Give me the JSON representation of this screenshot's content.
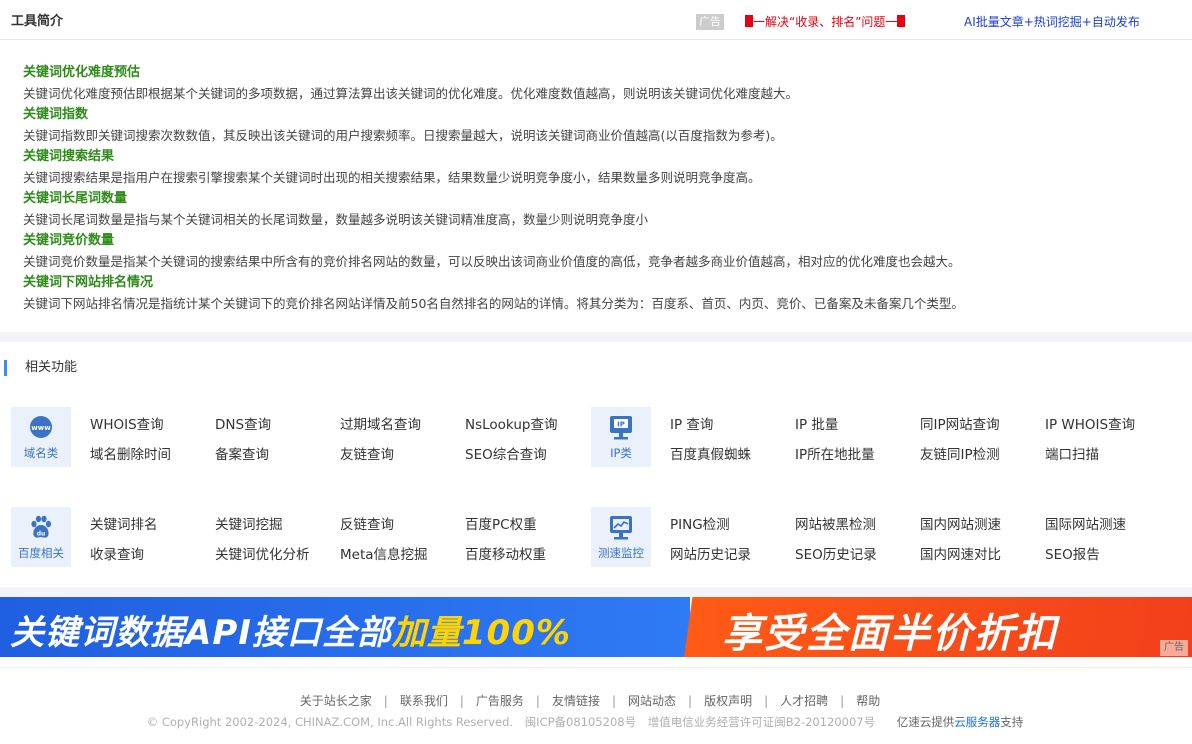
{
  "top": {
    "title": "工具简介",
    "ad_label": "广告",
    "promo_red": "一解决“收录、排名”问题一",
    "promo_blue": "AI批量文章+热词挖掘+自动发布"
  },
  "intro": [
    {
      "heading": "关键词优化难度预估",
      "text": "关键词优化难度预估即根据某个关键词的多项数据，通过算法算出该关键词的优化难度。优化难度数值越高，则说明该关键词优化难度越大。"
    },
    {
      "heading": "关键词指数",
      "text": "关键词指数即关键词搜索次数数值，其反映出该关键词的用户搜索频率。日搜索量越大，说明该关键词商业价值越高(以百度指数为参考)。"
    },
    {
      "heading": "关键词搜索结果",
      "text": "关键词搜索结果是指用户在搜索引擎搜索某个关键词时出现的相关搜索结果，结果数量少说明竞争度小，结果数量多则说明竞争度高。"
    },
    {
      "heading": "关键词长尾词数量",
      "text": "关键词长尾词数量是指与某个关键词相关的长尾词数量，数量越多说明该关键词精准度高，数量少则说明竞争度小"
    },
    {
      "heading": "关键词竞价数量",
      "text": "关键词竞价数量是指某个关键词的搜索结果中所含有的竞价排名网站的数量，可以反映出该词商业价值度的高低，竞争者越多商业价值越高，相对应的优化难度也会越大。"
    },
    {
      "heading": "关键词下网站排名情况",
      "text": "关键词下网站排名情况是指统计某个关键词下的竞价排名网站详情及前50名自然排名的网站的详情。将其分类为：百度系、首页、内页、竞价、已备案及未备案几个类型。"
    }
  ],
  "related": {
    "title": "相关功能",
    "categories": [
      {
        "label": "域名类",
        "icon": "www-icon",
        "links": [
          "WHOIS查询",
          "DNS查询",
          "过期域名查询",
          "NsLookup查询",
          "域名删除时间",
          "备案查询",
          "友链查询",
          "SEO综合查询"
        ]
      },
      {
        "label": "IP类",
        "icon": "ip-icon",
        "links": [
          "IP 查询",
          "IP 批量",
          "同IP网站查询",
          "IP WHOIS查询",
          "百度真假蜘蛛",
          "IP所在地批量",
          "友链同IP检测",
          "端口扫描"
        ]
      },
      {
        "label": "百度相关",
        "icon": "baidu-paw-icon",
        "links": [
          "关键词排名",
          "关键词挖掘",
          "反链查询",
          "百度PC权重",
          "收录查询",
          "关键词优化分析",
          "Meta信息挖掘",
          "百度移动权重"
        ]
      },
      {
        "label": "测速监控",
        "icon": "speed-monitor-icon",
        "links": [
          "PING检测",
          "网站被黑检测",
          "国内网站测速",
          "国际网站测速",
          "网站历史记录",
          "SEO历史记录",
          "国内网速对比",
          "SEO报告"
        ]
      }
    ]
  },
  "banner": {
    "text_main": "关键词数据API接口全部",
    "text_highlight": "加量100%",
    "text_right": "享受全面半价折扣",
    "ad_label": "广告"
  },
  "footer": {
    "links": [
      "关于站长之家",
      "联系我们",
      "广告服务",
      "友情链接",
      "网站动态",
      "版权声明",
      "人才招聘",
      "帮助"
    ],
    "copyright": "© CopyRight 2002-2024, CHINAZ.COM, Inc.All Rights Reserved.",
    "icp": "闽ICP备08105208号",
    "license": "增值电信业务经营许可证闽B2-20120007号",
    "provider_prefix": "亿速云提供",
    "provider_link": "云服务器",
    "provider_suffix": "支持"
  },
  "colors": {
    "accent_blue": "#3b8cf3",
    "heading_green": "#2e8b1a",
    "promo_red": "#e60012",
    "promo_blue": "#1a3fcc"
  }
}
